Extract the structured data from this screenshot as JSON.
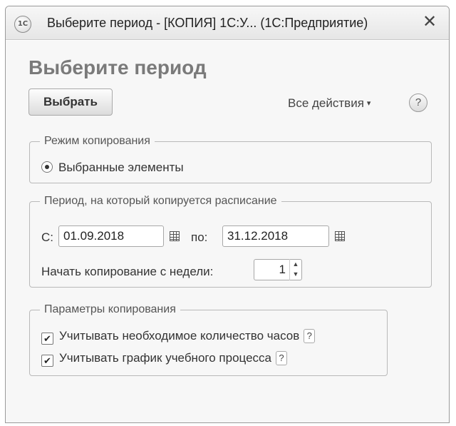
{
  "window": {
    "app_icon": "1c-logo-icon",
    "app_icon_text": "1С",
    "title": "Выберите период - [КОПИЯ] 1С:У... (1С:Предприятие)",
    "close_icon": "close-icon",
    "close_glyph": "✕"
  },
  "form": {
    "heading": "Выберите период",
    "select_button": "Выбрать",
    "all_actions": "Все действия",
    "all_actions_caret": "▾",
    "help": "?"
  },
  "copy_mode": {
    "legend": "Режим копирования",
    "option_label": "Выбранные элементы",
    "selected": true
  },
  "period": {
    "legend": "Период, на который копируется расписание",
    "from_label": "С:",
    "from_value": "01.09.2018",
    "to_label": "по:",
    "to_value": "31.12.2018",
    "week_label": "Начать копирование с недели:",
    "week_value": "1",
    "spin_up": "▲",
    "spin_down": "▼"
  },
  "params": {
    "legend": "Параметры копирования",
    "option1_label": "Учитывать необходимое количество часов",
    "option1_checked": true,
    "option2_label": "Учитывать график учебного процесса",
    "option2_checked": true,
    "help_mark": "?",
    "check_glyph": "✔"
  }
}
